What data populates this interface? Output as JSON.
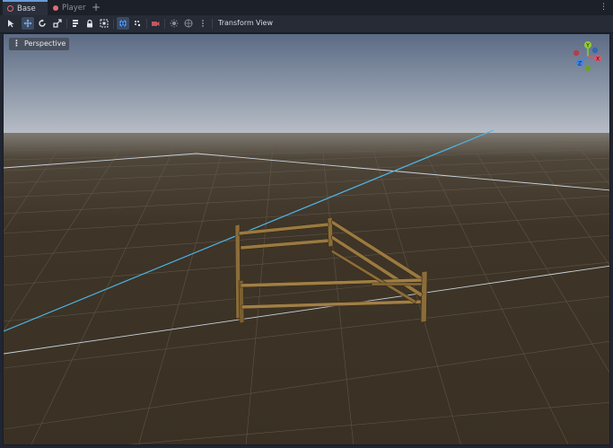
{
  "tabs": [
    {
      "label": "Base",
      "active": true,
      "icon": "scene-ring-icon"
    },
    {
      "label": "Player",
      "active": false,
      "icon": "scene-dot-icon"
    }
  ],
  "tab_add_label": "+",
  "tab_menu_label": "⋮",
  "toolbar": {
    "transform_label": "Transform",
    "view_label": "View"
  },
  "viewport": {
    "perspective_label": "Perspective",
    "gizmo": {
      "y": "Y",
      "x": "X",
      "z": "Z"
    }
  },
  "colors": {
    "accent": "#6c9bd8",
    "sky_top": "#5c6b85",
    "horizon": "#b7bdc6",
    "ground": "#3d3426",
    "fence": "#8b6d3a",
    "axis_x": "#e35468",
    "axis_y": "#8fcc33",
    "axis_z": "#3f84e5"
  }
}
